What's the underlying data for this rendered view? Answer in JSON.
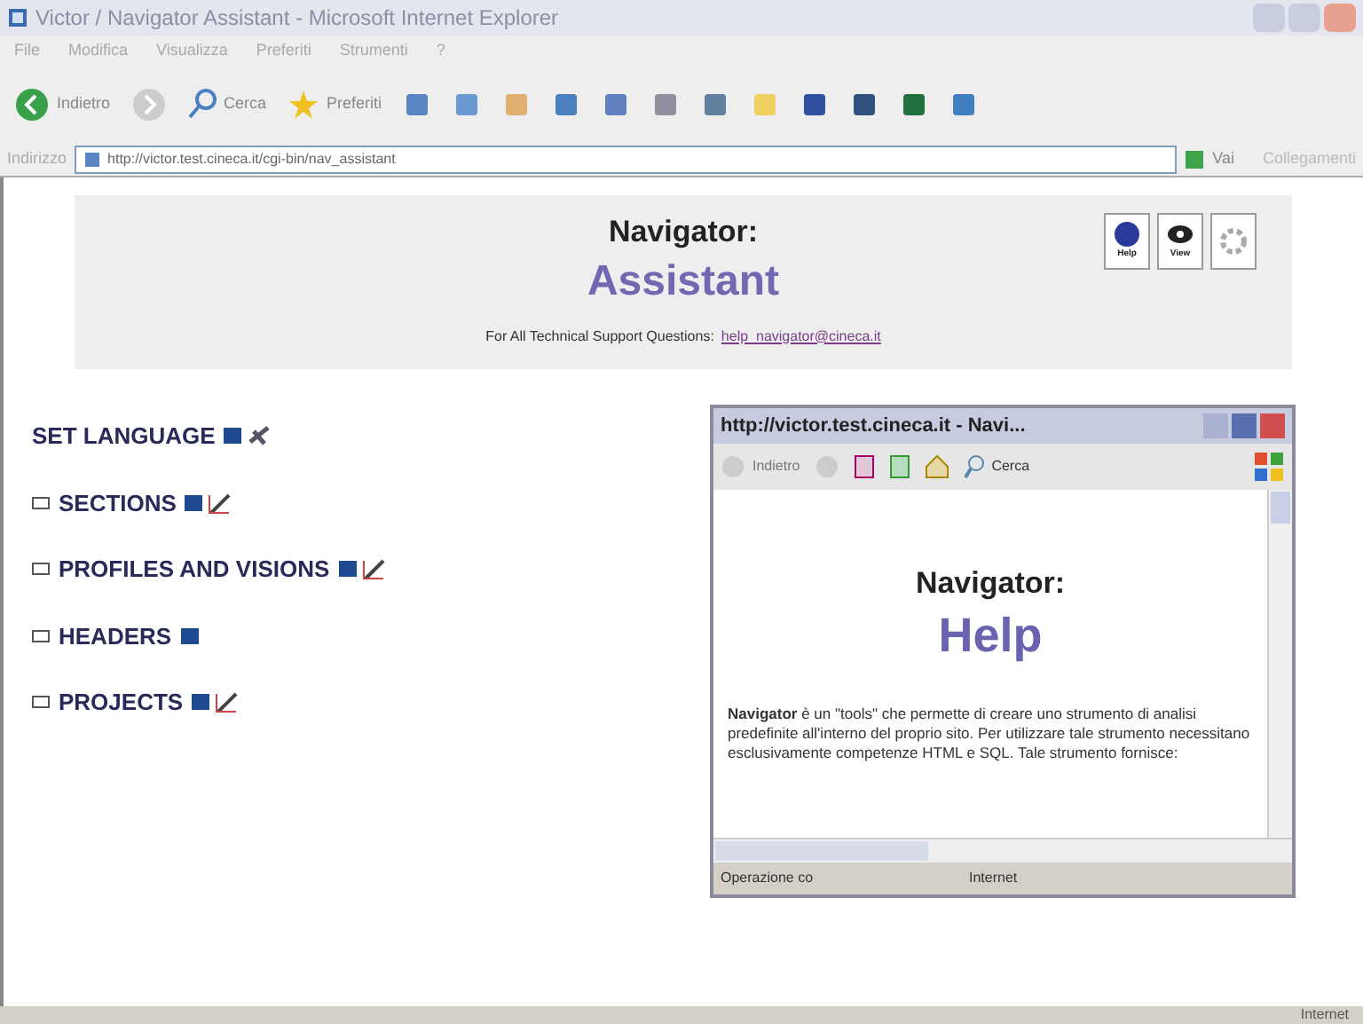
{
  "window": {
    "title": "Victor / Navigator Assistant - Microsoft Internet Explorer"
  },
  "menu": [
    "File",
    "Modifica",
    "Visualizza",
    "Preferiti",
    "Strumenti",
    "?"
  ],
  "toolbar": [
    {
      "label": "Indietro",
      "kind": "back"
    },
    {
      "kind": "forward"
    },
    {
      "label": "Cerca",
      "kind": "search"
    },
    {
      "label": "Preferiti",
      "kind": "favorites"
    }
  ],
  "address": {
    "label": "Indirizzo",
    "value": "http://victor.test.cineca.it/cgi-bin/nav_assistant",
    "go": "Vai",
    "links": "Collegamenti"
  },
  "header": {
    "title": "Navigator:",
    "subtitle": "Assistant",
    "support_text": "For All Technical Support Questions:",
    "support_link": "help_navigator@cineca.it",
    "buttons": [
      {
        "label": "Help",
        "kind": "help"
      },
      {
        "label": "View",
        "kind": "view"
      },
      {
        "kind": "settings"
      }
    ]
  },
  "items": [
    {
      "label": "SET LANGUAGE",
      "kind": "language",
      "edit": true
    },
    {
      "label": "SECTIONS",
      "kind": "section",
      "edit": true
    },
    {
      "label": "PROFILES AND VISIONS",
      "kind": "section",
      "edit": true
    },
    {
      "label": "HEADERS",
      "kind": "section",
      "edit": false
    },
    {
      "label": "PROJECTS",
      "kind": "section",
      "edit": true
    }
  ],
  "popup": {
    "title": "http://victor.test.cineca.it - Navi...",
    "back": "Indietro",
    "search": "Cerca",
    "title_text": "Navigator:",
    "subtitle": "Help",
    "paragraph": "**Navigator** è un \"tools\" che permette di creare uno strumento di analisi predefinite all'interno del proprio sito. Per utilizzare tale strumento necessitano esclusivamente competenze HTML e SQL.  Tale strumento fornisce:",
    "status": "Operazione co",
    "zone": "Internet"
  },
  "status_bar": {
    "zone": "Internet"
  }
}
